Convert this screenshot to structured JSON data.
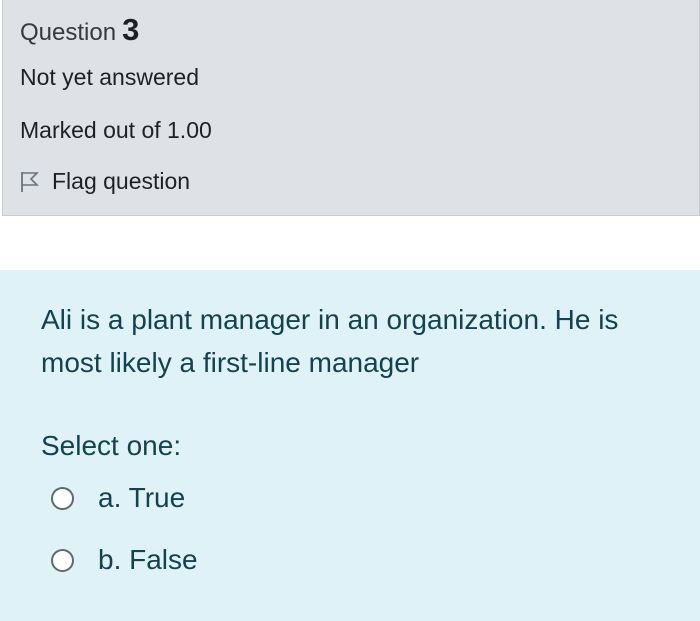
{
  "info": {
    "question_label": "Question",
    "question_number": "3",
    "state": "Not yet answered",
    "grade": "Marked out of 1.00",
    "flag_label": "Flag question"
  },
  "question": {
    "text": "Ali is a plant manager in an organization. He is most likely a first-line manager",
    "prompt": "Select one:",
    "options": [
      {
        "label": "a. True",
        "selected": false
      },
      {
        "label": "b. False",
        "selected": false
      }
    ]
  },
  "colors": {
    "info_background": "#dee2e6",
    "content_background": "#def2f8",
    "question_text": "#14424f"
  },
  "icons": {
    "flag": "flag-outline-icon"
  }
}
